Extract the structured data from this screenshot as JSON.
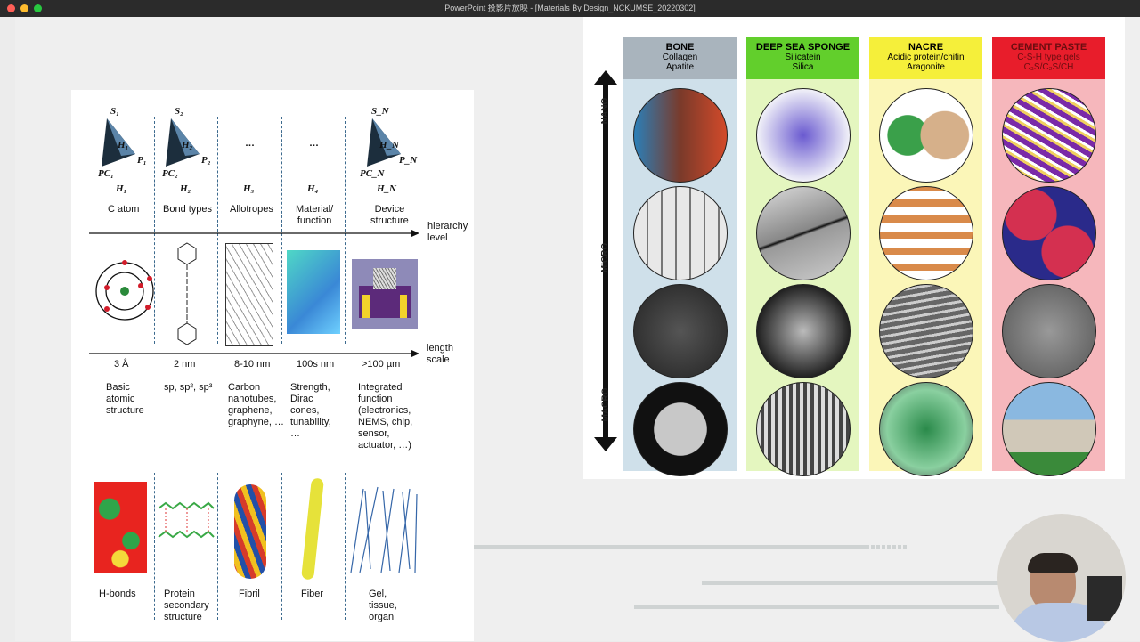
{
  "window": {
    "title": "PowerPoint 投影片放映 - [Materials By Design_NCKUMSE_20220302]"
  },
  "left_figure": {
    "hierarchy": [
      {
        "s": "S₁",
        "p": "P₁",
        "pc": "PC₁",
        "h": "H₁",
        "level": "H₁",
        "label": "C atom"
      },
      {
        "s": "S₂",
        "p": "P₂",
        "pc": "PC₂",
        "h": "H₂",
        "level": "H₂",
        "label": "Bond types"
      },
      {
        "s": "",
        "p": "",
        "pc": "",
        "h": "…",
        "level": "H₃",
        "label": "Allotropes"
      },
      {
        "s": "",
        "p": "",
        "pc": "",
        "h": "…",
        "level": "H₄",
        "label": "Material/\nfunction"
      },
      {
        "s": "S_N",
        "p": "P_N",
        "pc": "PC_N",
        "h": "H_N",
        "level": "H_N",
        "label": "Device\nstructure"
      }
    ],
    "axis_hierarchy": "hierarchy\nlevel",
    "axis_length": "length\nscale",
    "scales": [
      "3 Å",
      "2 nm",
      "8-10 nm",
      "100s nm",
      ">100 µm"
    ],
    "descriptions": [
      "Basic\natomic\nstructure",
      "sp, sp², sp³",
      "Carbon\nnanotubes,\ngraphene,\ngraphyne, …",
      "Strength,\nDirac\ncones,\ntunability,\n…",
      "Integrated\nfunction\n(electronics,\nNEMS, chip,\nsensor,\nactuator, …)"
    ],
    "bottom_labels": [
      "H-bonds",
      "Protein\nsecondary\nstructure",
      "Fibril",
      "Fiber",
      "Gel,\ntissue,\norgan"
    ]
  },
  "right_figure": {
    "scale_labels": [
      "NANO",
      "MICRO",
      "MACRO"
    ],
    "columns": [
      {
        "title": "BONE",
        "sub1": "Collagen",
        "sub2": "Apatite",
        "head_color": "#a9b4bd",
        "bg": "#cfe0ea",
        "title_color": "#111111"
      },
      {
        "title": "DEEP SEA SPONGE",
        "sub1": "Silicatein",
        "sub2": "Silica",
        "head_color": "#62cf2c",
        "bg": "#e4f6bf",
        "title_color": "#111111"
      },
      {
        "title": "NACRE",
        "sub1": "Acidic protein/chitin",
        "sub2": "Aragonite",
        "head_color": "#f5ef3a",
        "bg": "#fbf6b8",
        "title_color": "#111111"
      },
      {
        "title": "CEMENT PASTE",
        "sub1": "C-S-H type gels",
        "sub2": "C₃S/C₂S/CH",
        "head_color": "#e81d2b",
        "bg": "#f6b7bc",
        "title_color": "#6b0d10"
      }
    ]
  },
  "colors": {
    "titlebar": "#2b2b2b",
    "dashed": "#3c6a8e"
  }
}
